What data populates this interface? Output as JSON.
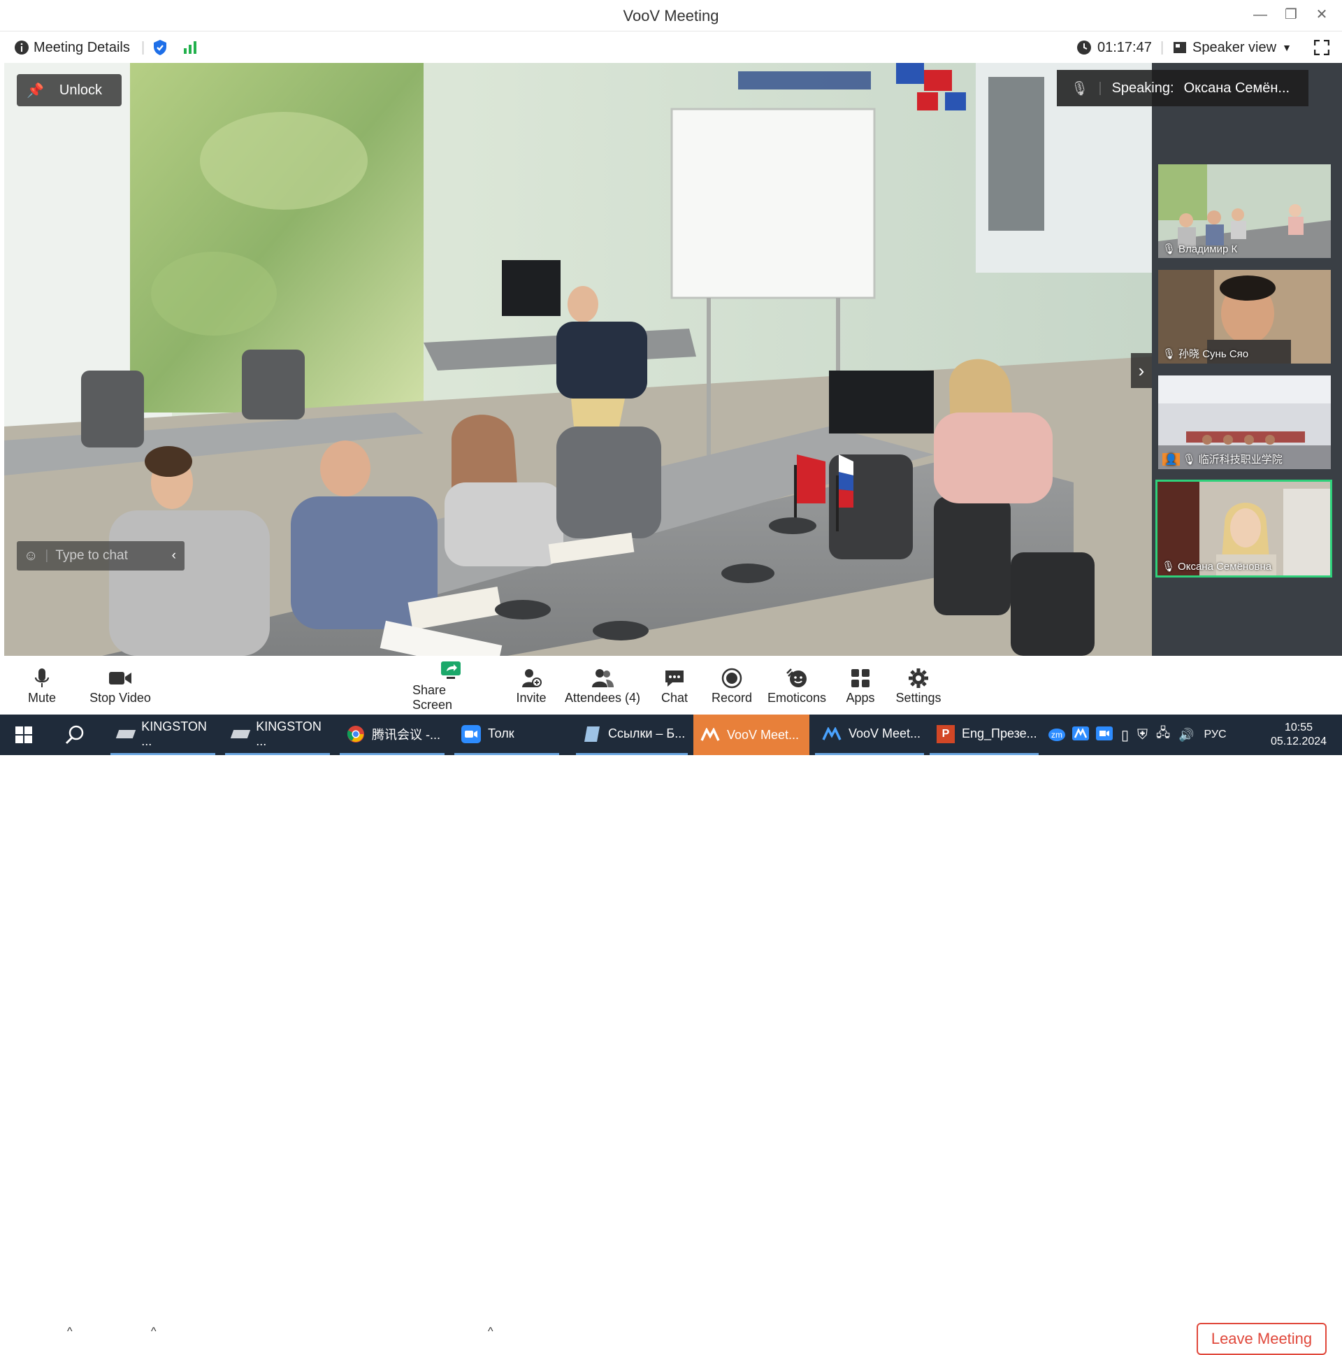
{
  "window": {
    "title": "VooV Meeting",
    "minimize_glyph": "—",
    "restore_glyph": "❐",
    "close_glyph": "✕"
  },
  "infobar": {
    "details_label": "Meeting Details",
    "timer": "01:17:47",
    "view_label": "Speaker view"
  },
  "overlay": {
    "unlock_label": "Unlock",
    "speaking_prefix": "Speaking:",
    "speaking_name": "Оксана Семён...",
    "chat_placeholder": "Type to chat"
  },
  "participants": [
    {
      "name": "Владимир К"
    },
    {
      "name": "孙晓 Сунь Сяо"
    },
    {
      "name": "临沂科技职业学院"
    },
    {
      "name": "Оксана Семёновна",
      "active": true
    }
  ],
  "toolbar": {
    "mute": "Mute",
    "stop_video": "Stop Video",
    "share_screen": "Share Screen",
    "invite": "Invite",
    "attendees": "Attendees (4)",
    "chat": "Chat",
    "record": "Record",
    "emoticons": "Emoticons",
    "apps": "Apps",
    "settings": "Settings",
    "leave": "Leave Meeting"
  },
  "taskbar": {
    "items": [
      {
        "label": "KINGSTON ..."
      },
      {
        "label": "KINGSTON ..."
      },
      {
        "label": "腾讯会议 -..."
      },
      {
        "label": "Толк"
      },
      {
        "label": "Ссылки – Б..."
      },
      {
        "label": "VooV Meet..."
      },
      {
        "label": "VooV Meet..."
      },
      {
        "label": "Eng_Презе..."
      }
    ],
    "tray_zm": "zm",
    "language": "РУС",
    "time": "10:55",
    "date": "05.12.2024"
  },
  "colors": {
    "accent_green": "#2fd07a",
    "leave_red": "#e0483b",
    "blue_shield": "#1e6fe8",
    "signal_green": "#23b14d",
    "taskbar_active": "#e8803a"
  }
}
